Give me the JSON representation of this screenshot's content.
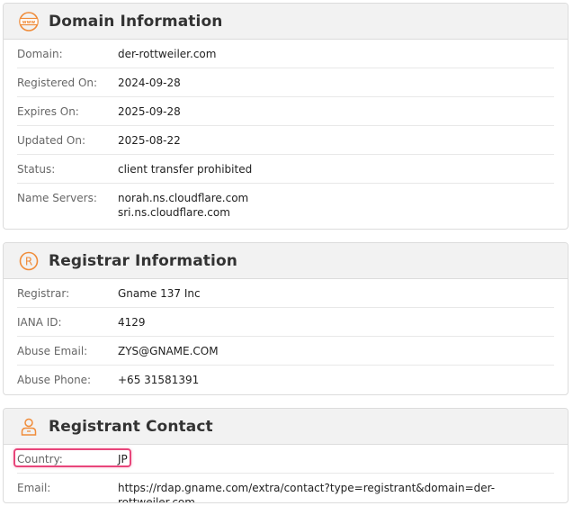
{
  "colors": {
    "accent": "#f08c3a",
    "header_bg": "#f2f2f2",
    "highlight": "#e8457a"
  },
  "domain_info": {
    "icon": "www-globe-icon",
    "title": "Domain Information",
    "rows": [
      {
        "label": "Domain:",
        "value": "der-rottweiler.com"
      },
      {
        "label": "Registered On:",
        "value": "2024-09-28"
      },
      {
        "label": "Expires On:",
        "value": "2025-09-28"
      },
      {
        "label": "Updated On:",
        "value": "2025-08-22"
      },
      {
        "label": "Status:",
        "value": "client transfer prohibited"
      },
      {
        "label": "Name Servers:",
        "values": [
          "norah.ns.cloudflare.com",
          "sri.ns.cloudflare.com"
        ]
      }
    ]
  },
  "registrar_info": {
    "icon": "registered-mark-icon",
    "title": "Registrar Information",
    "rows": [
      {
        "label": "Registrar:",
        "value": "Gname 137 Inc"
      },
      {
        "label": "IANA ID:",
        "value": "4129"
      },
      {
        "label": "Abuse Email:",
        "value": "ZYS@GNAME.COM"
      },
      {
        "label": "Abuse Phone:",
        "value": "+65 31581391"
      }
    ]
  },
  "registrant_contact": {
    "icon": "person-icon",
    "title": "Registrant Contact",
    "rows": [
      {
        "label": "Country:",
        "value": "JP"
      },
      {
        "label": "Email:",
        "value": "https://rdap.gname.com/extra/contact?type=registrant&domain=der-rottweiler.com"
      }
    ]
  }
}
